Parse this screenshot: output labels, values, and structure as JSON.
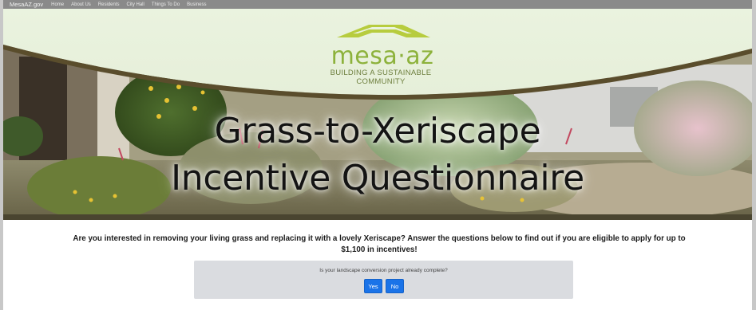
{
  "topnav": {
    "site_name": "MesaAZ.gov",
    "links": [
      "Home",
      "About Us",
      "Residents",
      "City Hall",
      "Things To Do",
      "Business"
    ]
  },
  "banner": {
    "logo_name": "mesa·az",
    "logo_tagline_1": "BUILDING A SUSTAINABLE",
    "logo_tagline_2": "COMMUNITY",
    "headline_1": "Grass-to-Xeriscape",
    "headline_2": "Incentive Questionnaire"
  },
  "intro": {
    "line_1": "Are you interested in removing your living grass and replacing it with a lovely Xeriscape? Answer the questions below to find out if you are eligible to apply for up to",
    "line_2": "$1,100 in incentives!"
  },
  "question": {
    "text": "Is your landscape conversion project already complete?",
    "yes_label": "Yes",
    "no_label": "No"
  },
  "colors": {
    "accent": "#1a73e8",
    "logo_green": "#8db23c",
    "nav_bg": "#8a8a8a",
    "card_bg": "#dadce0"
  }
}
